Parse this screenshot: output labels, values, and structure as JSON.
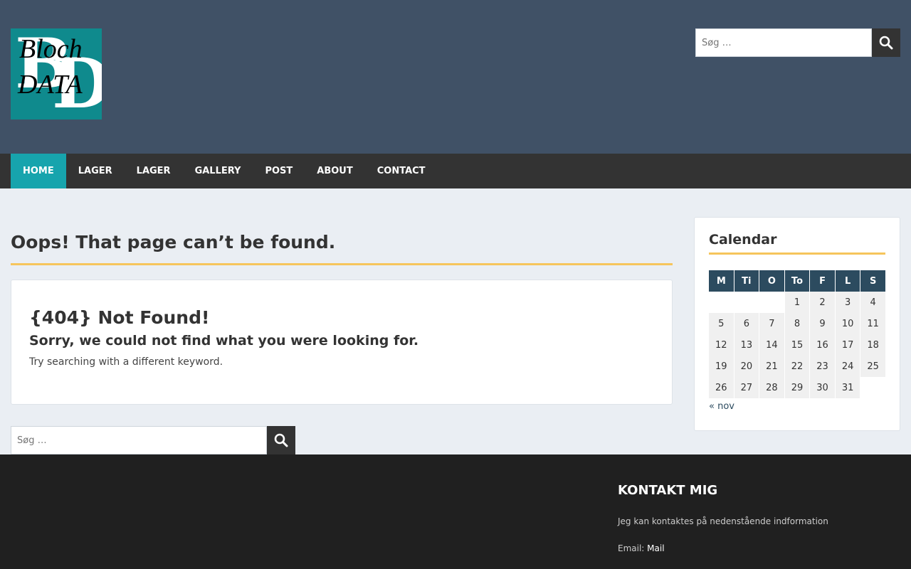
{
  "logo": {
    "letter1": "B",
    "letter2": "D",
    "line1": "Bloch",
    "line2": "DATA"
  },
  "header_search": {
    "placeholder": "Søg …"
  },
  "nav": {
    "items": [
      "Home",
      "Lager",
      "Lager",
      "Gallery",
      "Post",
      "About",
      "Contact"
    ]
  },
  "main": {
    "title": "Oops! That page can’t be found.",
    "heading": "{404} Not Found!",
    "subheading": "Sorry, we could not find what you were looking for.",
    "text": "Try searching with a different keyword.",
    "search_placeholder": "Søg …"
  },
  "calendar": {
    "title": "Calendar",
    "days": [
      "M",
      "Ti",
      "O",
      "To",
      "F",
      "L",
      "S"
    ],
    "weeks": [
      [
        "",
        "",
        "",
        "1",
        "2",
        "3",
        "4"
      ],
      [
        "5",
        "6",
        "7",
        "8",
        "9",
        "10",
        "11"
      ],
      [
        "12",
        "13",
        "14",
        "15",
        "16",
        "17",
        "18"
      ],
      [
        "19",
        "20",
        "21",
        "22",
        "23",
        "24",
        "25"
      ],
      [
        "26",
        "27",
        "28",
        "29",
        "30",
        "31",
        ""
      ]
    ],
    "prev_link": "« nov"
  },
  "footer": {
    "title": "Kontakt mig",
    "description": "Jeg kan kontaktes på nedenstående indformation",
    "email_label": "Email:",
    "email_link": "Mail"
  },
  "colors": {
    "header_bg": "#405166",
    "nav_bg": "#333333",
    "nav_active": "#17a4ad",
    "accent": "#f6c55c",
    "footer_bg": "#202020",
    "calendar_header": "#2c4b5f"
  }
}
